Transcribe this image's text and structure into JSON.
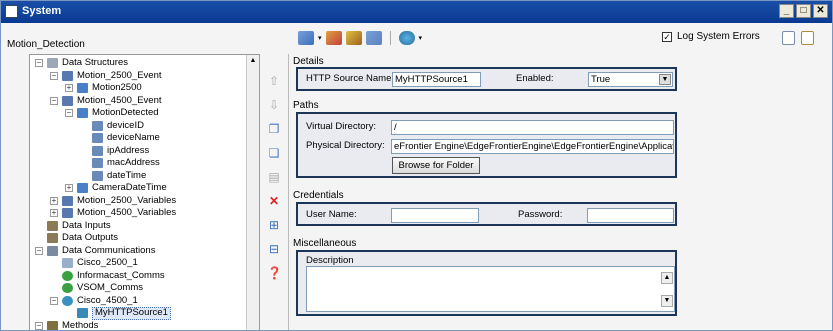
{
  "window": {
    "title": "System"
  },
  "project": {
    "name": "Motion_Detection"
  },
  "toolbar": {
    "log_system_errors_label": "Log System Errors",
    "log_system_errors_checked": "✓"
  },
  "tree": {
    "items": [
      {
        "label": "Data Structures",
        "level": 0,
        "exp": "−",
        "icon": "structures-icon"
      },
      {
        "label": "Motion_2500_Event",
        "level": 1,
        "exp": "−",
        "icon": "event-icon"
      },
      {
        "label": "Motion2500",
        "level": 2,
        "exp": "+",
        "icon": "table-icon"
      },
      {
        "label": "Motion_4500_Event",
        "level": 1,
        "exp": "−",
        "icon": "event-icon"
      },
      {
        "label": "MotionDetected",
        "level": 2,
        "exp": "−",
        "icon": "table-icon"
      },
      {
        "label": "deviceID",
        "level": 3,
        "exp": "",
        "icon": "field-icon"
      },
      {
        "label": "deviceName",
        "level": 3,
        "exp": "",
        "icon": "field-icon"
      },
      {
        "label": "ipAddress",
        "level": 3,
        "exp": "",
        "icon": "field-icon"
      },
      {
        "label": "macAddress",
        "level": 3,
        "exp": "",
        "icon": "field-icon"
      },
      {
        "label": "dateTime",
        "level": 3,
        "exp": "",
        "icon": "field-icon"
      },
      {
        "label": "CameraDateTime",
        "level": 2,
        "exp": "+",
        "icon": "table-icon"
      },
      {
        "label": "Motion_2500_Variables",
        "level": 1,
        "exp": "+",
        "icon": "event-icon"
      },
      {
        "label": "Motion_4500_Variables",
        "level": 1,
        "exp": "+",
        "icon": "event-icon"
      },
      {
        "label": "Data Inputs",
        "level": 0,
        "exp": "",
        "icon": "inputs-icon"
      },
      {
        "label": "Data Outputs",
        "level": 0,
        "exp": "",
        "icon": "outputs-icon"
      },
      {
        "label": "Data Communications",
        "level": 0,
        "exp": "−",
        "icon": "comms-icon"
      },
      {
        "label": "Cisco_2500_1",
        "level": 1,
        "exp": "",
        "icon": "doc-icon"
      },
      {
        "label": "Informacast_Comms",
        "level": 1,
        "exp": "",
        "icon": "comm-green-icon"
      },
      {
        "label": "VSOM_Comms",
        "level": 1,
        "exp": "",
        "icon": "comm-green-icon"
      },
      {
        "label": "Cisco_4500_1",
        "level": 1,
        "exp": "−",
        "icon": "globe-icon"
      },
      {
        "label": "MyHTTPSource1",
        "level": 2,
        "exp": "",
        "icon": "http-icon",
        "selected": true
      },
      {
        "label": "Methods",
        "level": 0,
        "exp": "−",
        "icon": "methods-icon"
      }
    ]
  },
  "details": {
    "section_label": "Details",
    "http_source_name_label": "HTTP Source Name:",
    "http_source_name_value": "MyHTTPSource1",
    "enabled_label": "Enabled:",
    "enabled_value": "True"
  },
  "paths": {
    "section_label": "Paths",
    "virtual_directory_label": "Virtual Directory:",
    "virtual_directory_value": "/",
    "physical_directory_label": "Physical Directory:",
    "physical_directory_value": "eFrontier Engine\\EdgeFrontierEngine\\EdgeFrontierEngine\\ApplicationInf",
    "browse_button_label": "Browse for Folder"
  },
  "credentials": {
    "section_label": "Credentials",
    "user_name_label": "User Name:",
    "user_name_value": "",
    "password_label": "Password:",
    "password_value": ""
  },
  "misc": {
    "section_label": "Miscellaneous",
    "description_label": "Description",
    "description_value": ""
  },
  "colors": {
    "titlebar": "#0a3a90",
    "box_border": "#1d3557",
    "box_fill": "#e9ebf0"
  }
}
